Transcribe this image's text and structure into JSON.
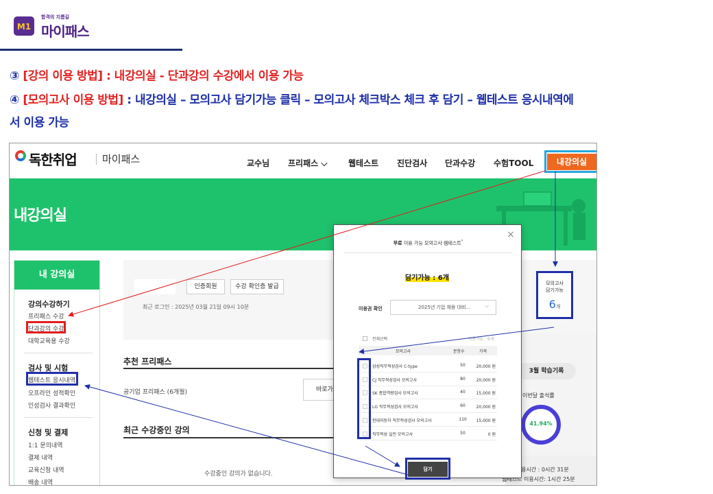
{
  "brand": {
    "mark": "M",
    "mark_digit": "1",
    "tagline": "합격의 지름길",
    "title": "마이패스"
  },
  "instructions": {
    "line1_num": "③",
    "line1_red": " [강의 이용 방법] : 내강의실 - 단과강의 수강에서 이용 가능",
    "line2_num": "④",
    "line2_bracket": " [모의고사 이용 방법]",
    "line2_rest": " : 내강의실 – 모의고사 담기가능 클릭 – 모의고사 체크박스 체크 후 담기 – 웹테스트 응시내역에",
    "line3": "서 이용 가능"
  },
  "site": {
    "logo": "독한취업",
    "logo_sub": "마이패스",
    "nav": [
      "교수님",
      "프리패스 ⌵",
      "웹테스트",
      "진단검사",
      "단과수강",
      "수험TOOL"
    ],
    "nav_my": "내강의실",
    "hero_title": "내강의실",
    "sidebar": {
      "head": "내 강의실",
      "sections": [
        {
          "title": "강의수강하기",
          "items": [
            "프리패스 수강",
            "단과강의 수강",
            "대학교육용 수강"
          ]
        },
        {
          "title": "검사 및 시험",
          "items": [
            "웹테스트 응시내역",
            "오프라인 성적확인",
            "인성검사 결과확인"
          ]
        },
        {
          "title": "신청 및 결제",
          "items": [
            "1:1 문의내역",
            "결제 내역",
            "교육신청 내역",
            "배송 내역"
          ]
        }
      ]
    },
    "chips": [
      "인증회원",
      "수강 확인증 발급"
    ],
    "last_login": "최근 로그인 : 2025년 03월 21일 09시 10분",
    "recommend_title": "추천 프리패스",
    "package": "공기업 프리패스 (6개월)",
    "go_btn": "바로가",
    "recent_title": "최근 수강중인 강의",
    "empty_text": "수강중인 강의가 없습니다.",
    "mock": {
      "label1": "모의고사",
      "label2": "담기가능",
      "count": "6",
      "unit": "개"
    },
    "study_btn": "3월 학습기록",
    "attendance_label": "이번달 출석률",
    "attendance_value": "41.94%",
    "time1": "용시간 : 0시간 31분",
    "time2": "웹테스트 이용시간: 1시간 25분"
  },
  "modal": {
    "title_bold": "무료",
    "title_rest": " 이용 가능 모의고사 웹테스트",
    "title_sup": "*",
    "close": "×",
    "available": "담기가능 : 6개",
    "voucher_label": "이용권 확인",
    "voucher_value": "2025년 기업 채용 대비...",
    "select_all": "전체선택",
    "usage": "이용가능 : 6개",
    "headers": [
      "모의고사",
      "문항수",
      "가격"
    ],
    "rows": [
      {
        "name": "삼성직무적성검사 C-type",
        "count": "50",
        "price": "20,000 원"
      },
      {
        "name": "CJ 직무적성검사 모의고사",
        "count": "80",
        "price": "20,000 원"
      },
      {
        "name": "SK 종합역량검사 모의고사",
        "count": "40",
        "price": "15,000 원"
      },
      {
        "name": "LG 직무적성검사 모의고사",
        "count": "60",
        "price": "20,000 원"
      },
      {
        "name": "현대자동차 직무적성검사 모의고사",
        "count": "110",
        "price": "15,000 원"
      },
      {
        "name": "직무적성 실전 모의고사",
        "count": "50",
        "price": "0 원"
      }
    ],
    "save": "담기"
  },
  "colors": {
    "brand_purple": "#5a2d91",
    "instr_blue": "#1c2fa8",
    "instr_red": "#e32222",
    "hero_green": "#1fc26c",
    "nav_orange": "#ef6820",
    "highlight_cyan": "#25a6e0",
    "highlight_blue": "#1f2fa8"
  }
}
